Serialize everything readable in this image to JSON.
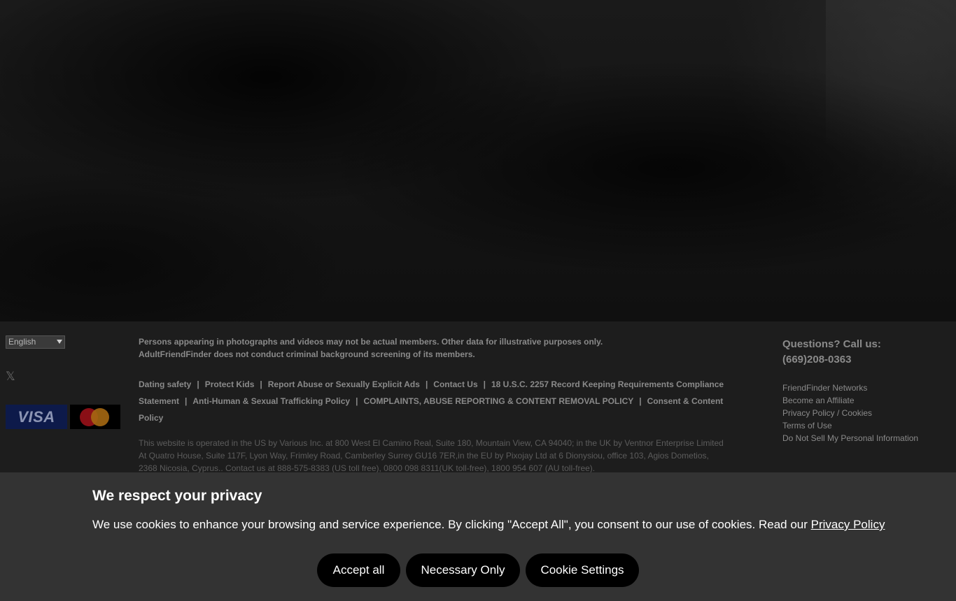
{
  "footer": {
    "language": "English",
    "social_icon": "x-icon",
    "payment": {
      "visa_label": "VISA",
      "mastercard_icon": "mastercard-icon"
    },
    "disclaimer_line1": "Persons appearing in photographs and videos may not be actual members. Other data for illustrative purposes only.",
    "disclaimer_line2": "AdultFriendFinder does not conduct criminal background screening of its members.",
    "links": [
      "Dating safety",
      "Protect Kids",
      "Report Abuse or Sexually Explicit Ads",
      "Contact Us",
      "18 U.S.C. 2257 Record Keeping Requirements Compliance Statement",
      "Anti-Human & Sexual Trafficking Policy",
      "COMPLAINTS, ABUSE REPORTING & CONTENT REMOVAL POLICY",
      "Consent & Content Policy"
    ],
    "legal_text": "This website is operated in the US by Various Inc. at 800 West El Camino Real, Suite 180, Mountain View, CA 94040; in the UK by Ventnor Enterprise Limited At Quatro House, Suite 117F, Lyon Way, Frimley Road, Camberley Surrey GU16 7ER,in the EU by Pixojay Ltd at 6 Dionysiou, office 103, Agios Dometios, 2368 Nicosia, Cyprus.. Contact us at 888-575-8383 (US toll free), 0800 098 8311(UK toll-free), 1800 954 607 (AU toll-free).",
    "contact": {
      "question": "Questions? Call us:",
      "phone": "(669)208-0363",
      "links": [
        "FriendFinder Networks",
        "Become an Affiliate",
        "Privacy Policy / Cookies",
        "Terms of Use",
        "Do Not Sell My Personal Information"
      ]
    }
  },
  "cookie_banner": {
    "title": "We respect your privacy",
    "message": "We use cookies to enhance your browsing and service experience. By clicking \"Accept All\", you consent to our use of cookies. Read our ",
    "privacy_link": "Privacy Policy",
    "buttons": {
      "accept": "Accept all",
      "necessary": "Necessary Only",
      "settings": "Cookie Settings"
    }
  }
}
